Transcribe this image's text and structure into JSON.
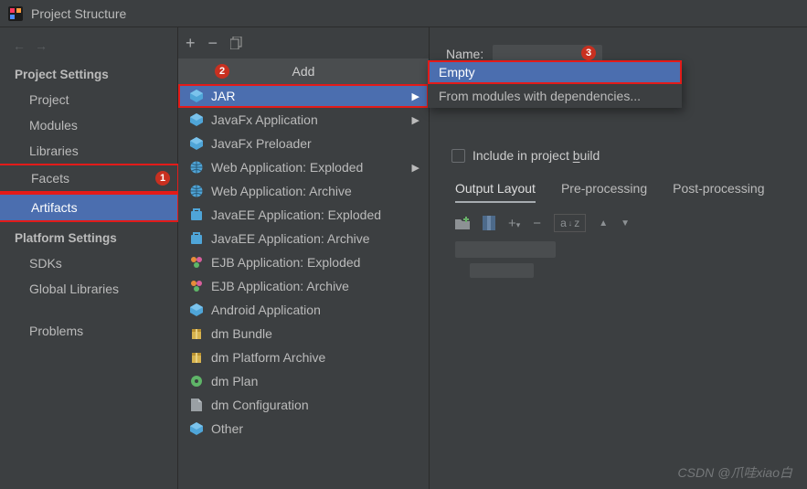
{
  "window": {
    "title": "Project Structure"
  },
  "sidebar": {
    "groups": [
      {
        "header": "Project Settings",
        "items": [
          {
            "label": "Project"
          },
          {
            "label": "Modules"
          },
          {
            "label": "Libraries"
          },
          {
            "label": "Facets",
            "callout": "1"
          },
          {
            "label": "Artifacts",
            "selected": true
          }
        ]
      },
      {
        "header": "Platform Settings",
        "items": [
          {
            "label": "SDKs"
          },
          {
            "label": "Global Libraries"
          }
        ]
      },
      {
        "header": "",
        "items": [
          {
            "label": "Problems"
          }
        ]
      }
    ]
  },
  "add_popup": {
    "title": "Add",
    "callout": "2",
    "items": [
      {
        "label": "JAR",
        "selected": true,
        "submenu": true,
        "icon": "module"
      },
      {
        "label": "JavaFx Application",
        "submenu": true,
        "icon": "module"
      },
      {
        "label": "JavaFx Preloader",
        "icon": "module"
      },
      {
        "label": "Web Application: Exploded",
        "submenu": true,
        "icon": "web"
      },
      {
        "label": "Web Application: Archive",
        "icon": "web"
      },
      {
        "label": "JavaEE Application: Exploded",
        "icon": "ee"
      },
      {
        "label": "JavaEE Application: Archive",
        "icon": "ee"
      },
      {
        "label": "EJB Application: Exploded",
        "icon": "ejb"
      },
      {
        "label": "EJB Application: Archive",
        "icon": "ejb"
      },
      {
        "label": "Android Application",
        "icon": "module"
      },
      {
        "label": "dm Bundle",
        "icon": "bundle"
      },
      {
        "label": "dm Platform Archive",
        "icon": "bundle"
      },
      {
        "label": "dm Plan",
        "icon": "plan"
      },
      {
        "label": "dm Configuration",
        "icon": "file"
      },
      {
        "label": "Other",
        "icon": "module"
      }
    ]
  },
  "main": {
    "name_label": "Name:",
    "callout": "3",
    "include_label_pre": "Include in project ",
    "include_label_u": "b",
    "include_label_post": "uild",
    "tabs": [
      {
        "label": "Output Layout",
        "active": true
      },
      {
        "label": "Pre-processing"
      },
      {
        "label": "Post-processing"
      }
    ],
    "sub_popup": [
      {
        "label": "Empty",
        "selected": true
      },
      {
        "label": "From modules with dependencies..."
      }
    ]
  },
  "watermark": "CSDN @爪哇xiao白"
}
